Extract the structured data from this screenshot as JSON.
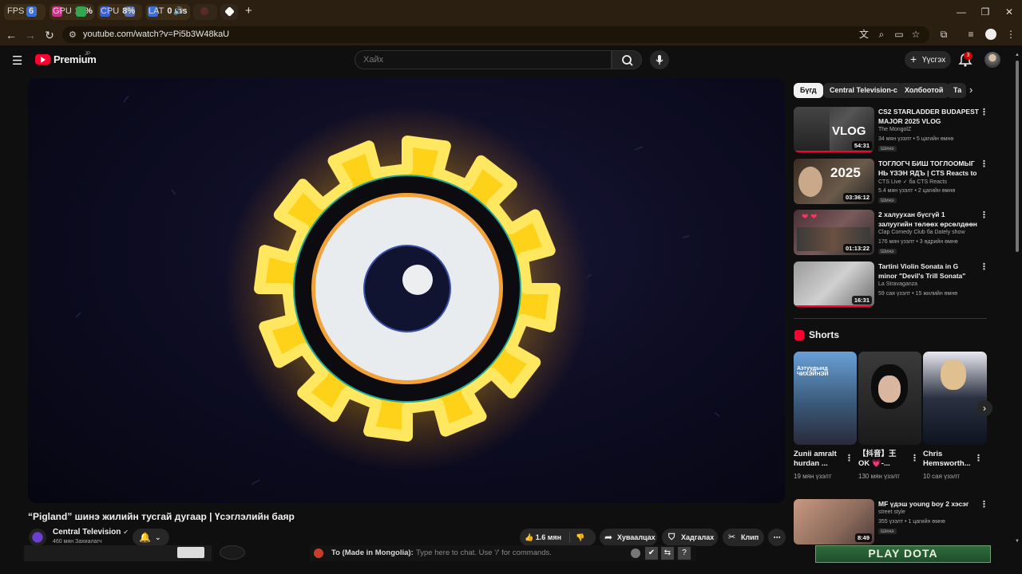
{
  "overlay": {
    "fps_label": "FPS",
    "fps_value": "6",
    "gpu_label": "GPU",
    "gpu_value": "15%",
    "cpu_label": "CPU",
    "cpu_value": "8%",
    "lat_label": "LAT",
    "lat_value": "0 ms"
  },
  "browser": {
    "url": "youtube.com/watch?v=Pi5b3W48kaU",
    "new_tab_glyph": "+"
  },
  "youtube": {
    "logo_text": "Premium",
    "logo_region": "JP",
    "search_placeholder": "Хайх",
    "create_label": "Үүсгэх",
    "notification_count": "3"
  },
  "video": {
    "title": "“Pigland” шинэ жилийн тусгай дугаар | Үсэглэлийн баяр",
    "channel": "Central Television",
    "subscribers": "460 мян Захиалагч",
    "likes": "1.6 мян",
    "share_label": "Хуваалцах",
    "save_label": "Хадгалах",
    "clip_label": "Клип"
  },
  "chips": [
    "Бүгд",
    "Central Television-с",
    "Холбоотой",
    "Та"
  ],
  "recommendations": [
    {
      "title": "CS2 STARLADDER BUDAPEST MAJOR 2025 VLOG",
      "channel": "The MongolZ",
      "meta": "34 мян үзэлт • 5 цагийн өмнө",
      "badge": "Шинэ",
      "duration": "54:31",
      "thumb_text": "VLOG"
    },
    {
      "title": "ТОГЛОГЧ БИШ ТОГЛООМЫГ НЬ ҮЗЭН ЯДЪ | CTS Reacts to ...",
      "channel": "CTS Live ✓ ба CTS Reacts",
      "meta": "5.4 мян үзэлт • 2 цагийн өмнө",
      "badge": "Шинэ",
      "duration": "03:36:12",
      "thumb_text": "2025"
    },
    {
      "title": "2 халуухан бүсгүй 1 залуугийн төлөөх өрсөлдөөн 😍🤭👂 ...",
      "channel": "Clap Comedy Club ба Dately show",
      "meta": "176 мян үзэлт • 3 өдрийн өмнө",
      "badge": "Шинэ",
      "duration": "01:13:22",
      "thumb_text": ""
    },
    {
      "title": "Tartini Violin Sonata in G minor \"Devil's Trill Sonata\"",
      "channel": "La Stravaganza",
      "meta": "59 сая үзэлт • 15 жилийн өмнө",
      "badge": "",
      "duration": "16:31",
      "thumb_text": ""
    }
  ],
  "shorts_heading": "Shorts",
  "shorts": [
    {
      "title": "Zunii amralt hurdan ...",
      "views": "19 мян үзэлт",
      "thumb_text": "Азтуудынд ЧИХЭЙНЭЙ"
    },
    {
      "title": "【抖音】王 OK 💗-...",
      "views": "130 мян үзэлт",
      "thumb_text": ""
    },
    {
      "title": "Chris Hemsworth...",
      "views": "10 сая үзэлт",
      "thumb_text": ""
    }
  ],
  "bottom_rec": {
    "title": "MF үдэш young boy 2 хэсэг",
    "channel": "street style",
    "meta": "355 үзэлт • 1 цагийн өмнө",
    "badge": "Шинэ",
    "duration": "8:49"
  },
  "chat": {
    "to_label": "To (Made in Mongolia):",
    "placeholder": "Type here to chat. Use '/' for commands."
  },
  "game_banner": "PLAY DOTA",
  "colors": {
    "yt_red": "#ff0033",
    "chrome_bg": "#2a1f10",
    "page_bg": "#0f0f0f",
    "gear_yellow": "#ffd21a",
    "eye_white": "#e8ecef"
  }
}
